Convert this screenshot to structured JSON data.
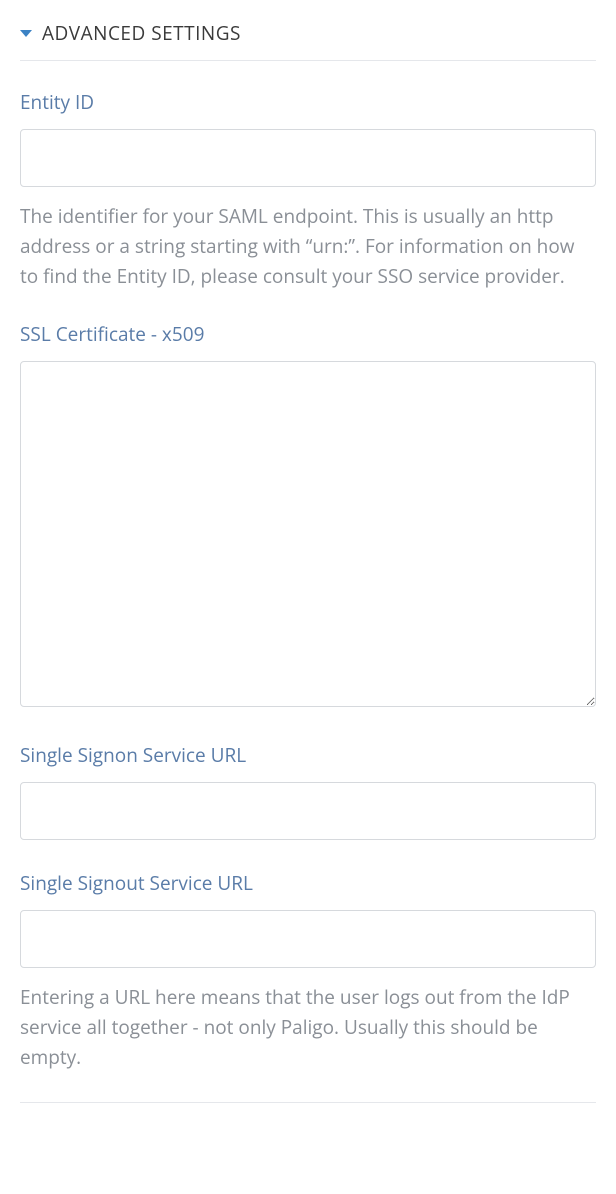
{
  "section": {
    "title": "ADVANCED SETTINGS"
  },
  "fields": {
    "entity_id": {
      "label": "Entity ID",
      "value": "",
      "help": "The identifier for your SAML endpoint. This is usually an http address or a string starting with “urn:”. For information on how to find the Entity ID, please consult your SSO service provider."
    },
    "ssl_cert": {
      "label": "SSL Certificate - x509",
      "value": ""
    },
    "signon_url": {
      "label": "Single Signon Service URL",
      "value": ""
    },
    "signout_url": {
      "label": "Single Signout Service URL",
      "value": "",
      "help": "Entering a URL here means that the user logs out from the IdP service all together - not only Paligo. Usually this should be empty."
    }
  }
}
